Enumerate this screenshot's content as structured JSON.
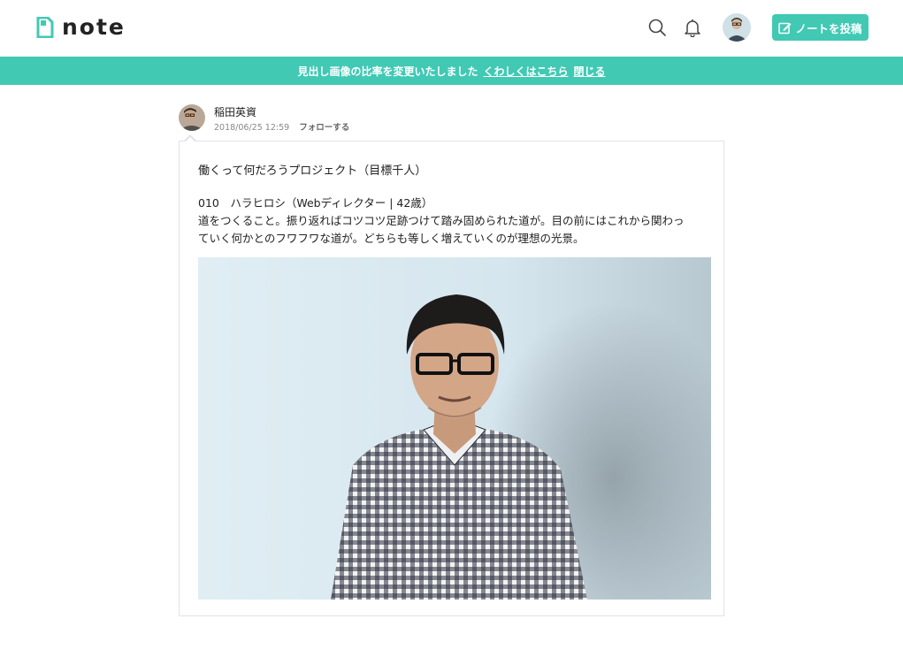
{
  "header": {
    "logo_text": "note",
    "post_button_label": "ノートを投稿",
    "icons": [
      "note-logo-icon",
      "search-icon",
      "bell-icon",
      "pencil-square-icon"
    ]
  },
  "banner": {
    "message": "見出し画像の比率を変更いたしました",
    "link_details": "くわしくはこちら",
    "link_close": "閉じる"
  },
  "post": {
    "author_name": "稲田英資",
    "timestamp": "2018/06/25 12:59",
    "follow_label": "フォローする",
    "title": "働くって何だろうプロジェクト（目標千人）",
    "body_lines": [
      "010　ハラヒロシ（Webディレクター | 42歳）",
      "道をつくること。振り返ればコツコツ足跡つけて踏み固められた道が。目の前にはこれから関わっ",
      "ていく何かとのフワフワな道が。どちらも等しく増えていくのが理想の光景。"
    ]
  },
  "colors": {
    "accent": "#41c9b4",
    "card_border": "#e3e3e3",
    "text": "#222222",
    "meta_text": "#888888"
  }
}
